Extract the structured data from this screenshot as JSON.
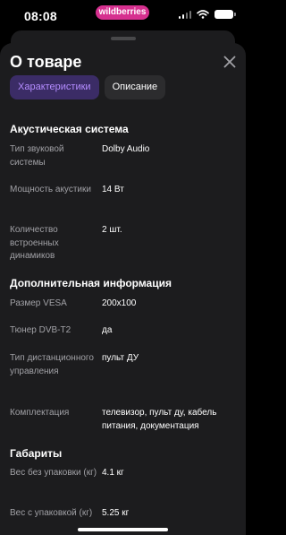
{
  "status_bar": {
    "time": "08:08",
    "brand": "wildberries"
  },
  "sheet": {
    "title": "О товаре",
    "tabs": [
      {
        "label": "Характеристики",
        "active": true
      },
      {
        "label": "Описание",
        "active": false
      }
    ]
  },
  "sections": [
    {
      "title": "Акустическая система",
      "rows": [
        {
          "label": "Тип звуковой системы",
          "value": "Dolby Audio"
        },
        {
          "label": "Мощность акустики",
          "value": "14 Вт"
        },
        {
          "label": "Количество встроенных динамиков",
          "value": "2 шт."
        }
      ]
    },
    {
      "title": "Дополнительная информация",
      "rows": [
        {
          "label": "Размер VESA",
          "value": "200x100"
        },
        {
          "label": "Тюнер DVB-T2",
          "value": "да"
        },
        {
          "label": "Тип дистанционного управления",
          "value": "пульт ДУ"
        },
        {
          "label": "Комплектация",
          "value": "телевизор, пульт ду, кабель питания, документация"
        }
      ]
    },
    {
      "title": "Габариты",
      "rows": [
        {
          "label": "Вес без упаковки (кг)",
          "value": "4.1 кг"
        },
        {
          "label": "Вес с упаковкой (кг)",
          "value": "5.25 кг"
        }
      ]
    }
  ],
  "colors": {
    "background": "#000000",
    "sheet": "#1c1c1e",
    "accent": "#b48cff",
    "active_tab_bg": "#3b2c66",
    "brand": "#d6308f",
    "label": "#a1a1a6"
  }
}
